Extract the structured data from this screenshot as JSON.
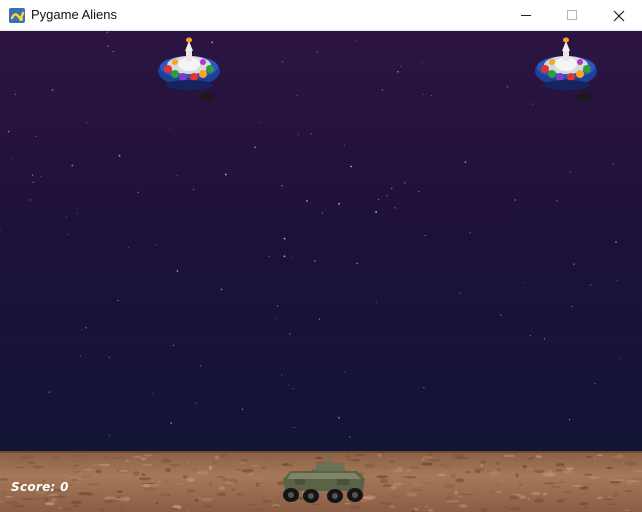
{
  "window": {
    "title": "Pygame Aliens",
    "icons": {
      "app": "pygame-snake-icon",
      "minimize": "minimize-icon",
      "maximize": "maximize-icon",
      "close": "close-icon"
    }
  },
  "hud": {
    "score_label": "Score: 0"
  },
  "sprites": {
    "aliens": [
      {
        "name": "alien-ufo",
        "icon": "ufo-icon"
      },
      {
        "name": "alien-ufo",
        "icon": "ufo-icon"
      }
    ],
    "player": {
      "name": "player-tank",
      "icon": "tank-icon"
    }
  },
  "colors": {
    "sky_top": "#2a1440",
    "sky_bottom": "#121235",
    "ground": "#9a6c4c",
    "score_text": "#ffffff",
    "titlebar": "#ffffff"
  }
}
